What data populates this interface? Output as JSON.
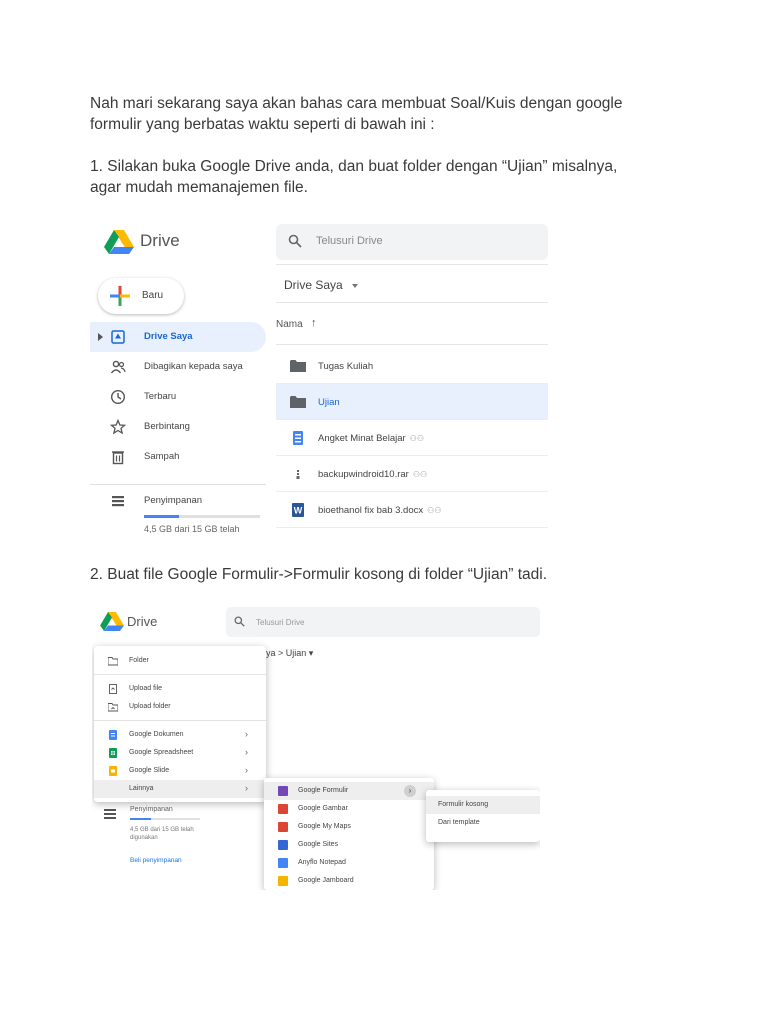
{
  "intro": {
    "line1": "Nah mari sekarang saya akan bahas cara membuat Soal/Kuis dengan google",
    "line2": "formulir yang berbatas waktu seperti di bawah ini :"
  },
  "step1": {
    "line1": "1. Silakan buka Google Drive anda, dan buat folder dengan “Ujian” misalnya,",
    "line2": "agar mudah memanajemen file."
  },
  "step2": {
    "text": "2. Buat file Google Formulir->Formulir kosong di folder “Ujian” tadi."
  },
  "screenshot1": {
    "brand": "Drive",
    "search_placeholder": "Telusuri Drive",
    "new_button": "Baru",
    "nav": [
      {
        "label": "Drive Saya",
        "icon": "my-drive-icon"
      },
      {
        "label": "Dibagikan kepada saya",
        "icon": "shared-with-me-icon"
      },
      {
        "label": "Terbaru",
        "icon": "clock-icon"
      },
      {
        "label": "Berbintang",
        "icon": "star-icon"
      },
      {
        "label": "Sampah",
        "icon": "trash-icon"
      }
    ],
    "storage_label": "Penyimpanan",
    "storage_used_fraction": 0.3,
    "storage_text": "4,5 GB dari 15 GB telah",
    "breadcrumb": "Drive Saya",
    "column_header": "Nama",
    "files": [
      {
        "name": "Tugas Kuliah",
        "type": "folder",
        "shared": false
      },
      {
        "name": "Ujian",
        "type": "folder",
        "shared": false
      },
      {
        "name": "Angket Minat Belajar",
        "type": "form",
        "shared": true
      },
      {
        "name": "backupwindroid10.rar",
        "type": "archive",
        "shared": true
      },
      {
        "name": "bioethanol fix bab 3.docx",
        "type": "word",
        "shared": true
      }
    ],
    "colors": {
      "accent": "#1967d2",
      "selected_bg": "#e8f0fe"
    }
  },
  "screenshot2": {
    "brand": "Drive",
    "search_placeholder": "Telusuri Drive",
    "breadcrumb": "ya  >  Ujian  ▾",
    "menu": [
      {
        "label": "Folder",
        "icon": "folder-icon"
      },
      {
        "label": "Upload file",
        "icon": "file-upload-icon"
      },
      {
        "label": "Upload folder",
        "icon": "folder-upload-icon"
      },
      {
        "label": "Google Dokumen",
        "icon": "docs-icon",
        "arrow": "›"
      },
      {
        "label": "Google Spreadsheet",
        "icon": "sheets-icon",
        "arrow": "›"
      },
      {
        "label": "Google Slide",
        "icon": "slides-icon",
        "arrow": "›"
      },
      {
        "label": "Lainnya",
        "icon": "",
        "arrow": "›"
      }
    ],
    "storage_label": "Penyimpanan",
    "storage_used_fraction": 0.3,
    "storage_text": "4,5 GB dari 15 GB telah digunakan",
    "buy_storage": "Beli penyimpanan",
    "submenu": [
      {
        "label": "Google Formulir",
        "color": "#7248b9"
      },
      {
        "label": "Google Gambar",
        "color": "#db4437"
      },
      {
        "label": "Google My Maps",
        "color": "#db4437"
      },
      {
        "label": "Google Sites",
        "color": "#3367d6"
      },
      {
        "label": "Anyflo Notepad",
        "color": "#4285f4"
      },
      {
        "label": "Google Jamboard",
        "color": "#f4b400"
      }
    ],
    "submenu_arrow": "›",
    "submenu2": [
      {
        "label": "Formulir kosong"
      },
      {
        "label": "Dari template"
      }
    ]
  }
}
